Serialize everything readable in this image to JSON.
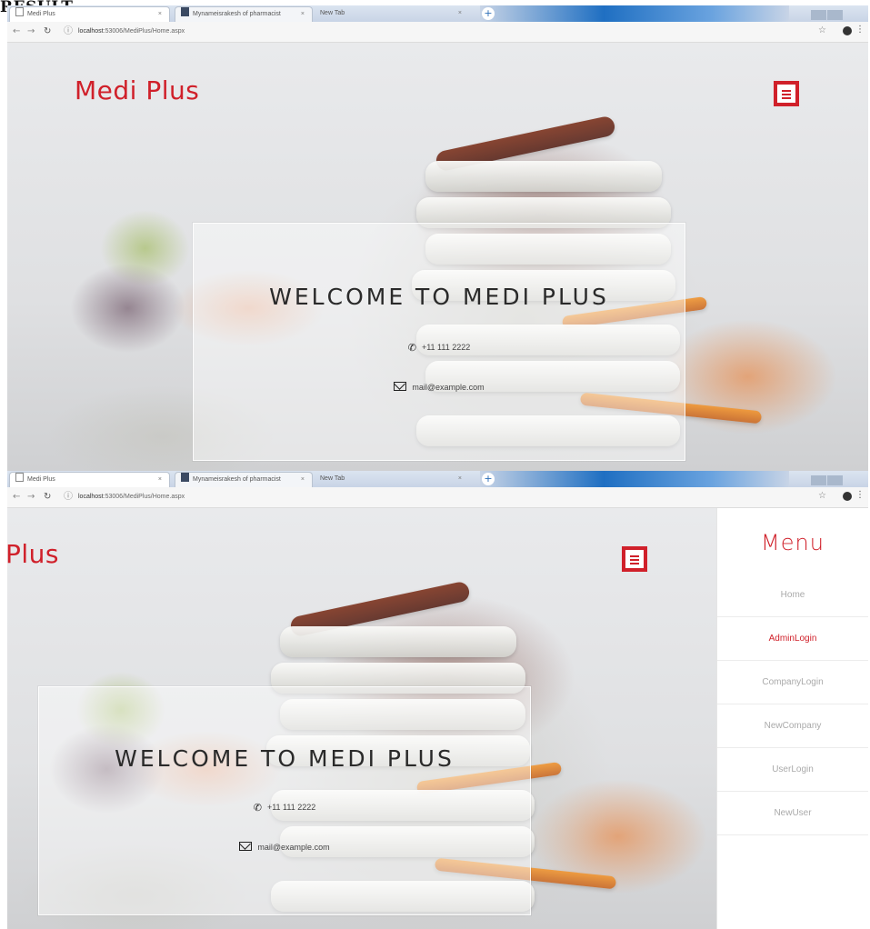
{
  "heading": "RESULT",
  "browser": {
    "tabs": [
      {
        "label": "Medi Plus",
        "close": "×"
      },
      {
        "label": "Mynameisrakesh of pharmacist",
        "close": "×"
      },
      {
        "label": "New Tab",
        "close": "×"
      }
    ],
    "new_tab": "+",
    "url_host": "localhost",
    "url_path": ":53006/MediPlus/Home.aspx",
    "icons": {
      "back": "←",
      "forward": "→",
      "reload": "↻",
      "info": "ⓘ",
      "bookmark": "☆",
      "menu": "⋮"
    }
  },
  "site": {
    "brand": "Medi Plus",
    "brand_partial": "Plus",
    "welcome": "WELCOME TO MEDI PLUS",
    "phone": "+11 111 2222",
    "email": "mail@example.com",
    "brand_color": "#d0202a"
  },
  "sidebar": {
    "title": "Menu",
    "items": [
      {
        "label": "Home",
        "active": false
      },
      {
        "label": "AdminLogin",
        "active": true
      },
      {
        "label": "CompanyLogin",
        "active": false
      },
      {
        "label": "NewCompany",
        "active": false
      },
      {
        "label": "UserLogin",
        "active": false
      },
      {
        "label": "NewUser",
        "active": false
      }
    ]
  }
}
